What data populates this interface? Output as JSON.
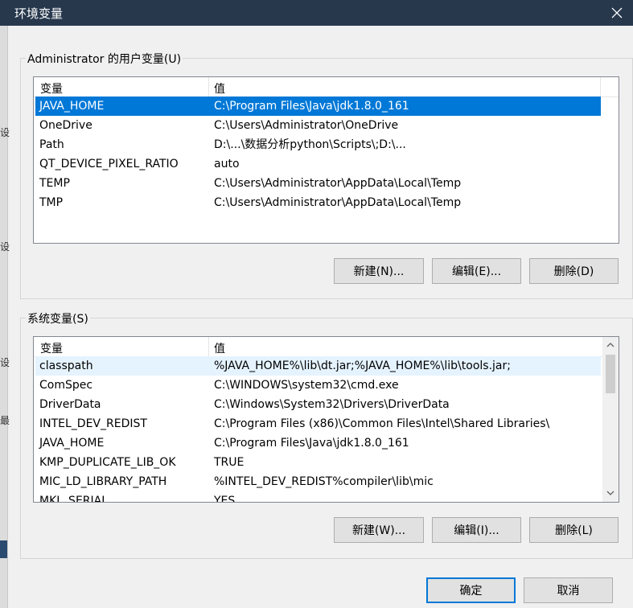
{
  "window": {
    "title": "环境变量"
  },
  "user_section": {
    "label": "Administrator 的用户变量(U)",
    "columns": [
      "变量",
      "值"
    ],
    "rows": [
      {
        "name": "JAVA_HOME",
        "value": "C:\\Program Files\\Java\\jdk1.8.0_161"
      },
      {
        "name": "OneDrive",
        "value": "C:\\Users\\Administrator\\OneDrive"
      },
      {
        "name": "Path",
        "value": "D:\\...\\数据分析python\\Scripts\\;D:\\..."
      },
      {
        "name": "QT_DEVICE_PIXEL_RATIO",
        "value": "auto"
      },
      {
        "name": "TEMP",
        "value": "C:\\Users\\Administrator\\AppData\\Local\\Temp"
      },
      {
        "name": "TMP",
        "value": "C:\\Users\\Administrator\\AppData\\Local\\Temp"
      }
    ],
    "selected_row": 0,
    "buttons": {
      "new": "新建(N)...",
      "edit": "编辑(E)...",
      "delete": "删除(D)"
    }
  },
  "system_section": {
    "label": "系统变量(S)",
    "columns": [
      "变量",
      "值"
    ],
    "rows": [
      {
        "name": "classpath",
        "value": "%JAVA_HOME%\\lib\\dt.jar;%JAVA_HOME%\\lib\\tools.jar;"
      },
      {
        "name": "ComSpec",
        "value": "C:\\WINDOWS\\system32\\cmd.exe"
      },
      {
        "name": "DriverData",
        "value": "C:\\Windows\\System32\\Drivers\\DriverData"
      },
      {
        "name": "INTEL_DEV_REDIST",
        "value": "C:\\Program Files (x86)\\Common Files\\Intel\\Shared Libraries\\"
      },
      {
        "name": "JAVA_HOME",
        "value": "C:\\Program Files\\Java\\jdk1.8.0_161"
      },
      {
        "name": "KMP_DUPLICATE_LIB_OK",
        "value": "TRUE"
      },
      {
        "name": "MIC_LD_LIBRARY_PATH",
        "value": "%INTEL_DEV_REDIST%compiler\\lib\\mic"
      },
      {
        "name": "MKL_SERIAL",
        "value": "YES"
      }
    ],
    "hover_row": 0,
    "buttons": {
      "new": "新建(W)...",
      "edit": "编辑(I)...",
      "delete": "删除(L)"
    }
  },
  "footer": {
    "ok": "确定",
    "cancel": "取消"
  },
  "colors": {
    "titlebar": "#27384d",
    "selection": "#0078d7",
    "hover": "#e5f3ff"
  },
  "icons": {
    "close": "close-icon",
    "scroll_up": "chevron-up-icon",
    "scroll_down": "chevron-down-icon"
  }
}
